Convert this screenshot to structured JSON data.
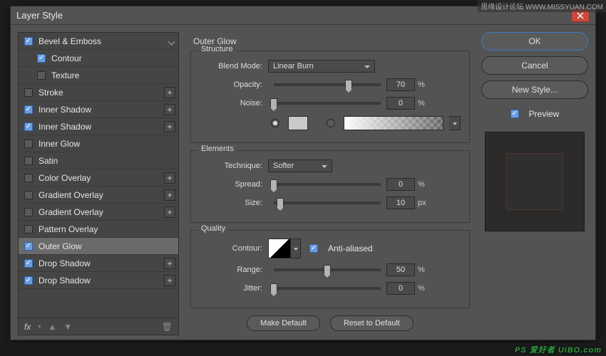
{
  "watermark": {
    "top": "思缘设计论坛    WWW.MISSYUAN.COM",
    "bottom_left": "",
    "bottom_right": "PS 爱好者  UiBO.com"
  },
  "dialog": {
    "title": "Layer Style"
  },
  "styles": {
    "bevel": "Bevel & Emboss",
    "contour": "Contour",
    "texture": "Texture",
    "stroke": "Stroke",
    "innerShadow1": "Inner Shadow",
    "innerShadow2": "Inner Shadow",
    "innerGlow": "Inner Glow",
    "satin": "Satin",
    "colorOverlay": "Color Overlay",
    "gradientOverlay1": "Gradient Overlay",
    "gradientOverlay2": "Gradient Overlay",
    "patternOverlay": "Pattern Overlay",
    "outerGlow": "Outer Glow",
    "dropShadow1": "Drop Shadow",
    "dropShadow2": "Drop Shadow",
    "fx": "fx"
  },
  "panel": {
    "title": "Outer Glow",
    "structure": {
      "title": "Structure",
      "blendMode": {
        "label": "Blend Mode",
        "value": "Linear Burn"
      },
      "opacity": {
        "label": "Opacity",
        "value": "70",
        "unit": "%"
      },
      "noise": {
        "label": "Noise",
        "value": "0",
        "unit": "%"
      }
    },
    "elements": {
      "title": "Elements",
      "technique": {
        "label": "Technique",
        "value": "Softer"
      },
      "spread": {
        "label": "Spread",
        "value": "0",
        "unit": "%"
      },
      "size": {
        "label": "Size",
        "value": "10",
        "unit": "px"
      }
    },
    "quality": {
      "title": "Quality",
      "contour": {
        "label": "Contour"
      },
      "antialiased": "Anti-aliased",
      "range": {
        "label": "Range",
        "value": "50",
        "unit": "%"
      },
      "jitter": {
        "label": "Jitter",
        "value": "0",
        "unit": "%"
      }
    },
    "makeDefault": "Make Default",
    "resetDefault": "Reset to Default"
  },
  "buttons": {
    "ok": "OK",
    "cancel": "Cancel",
    "newStyle": "New Style...",
    "preview": "Preview"
  }
}
